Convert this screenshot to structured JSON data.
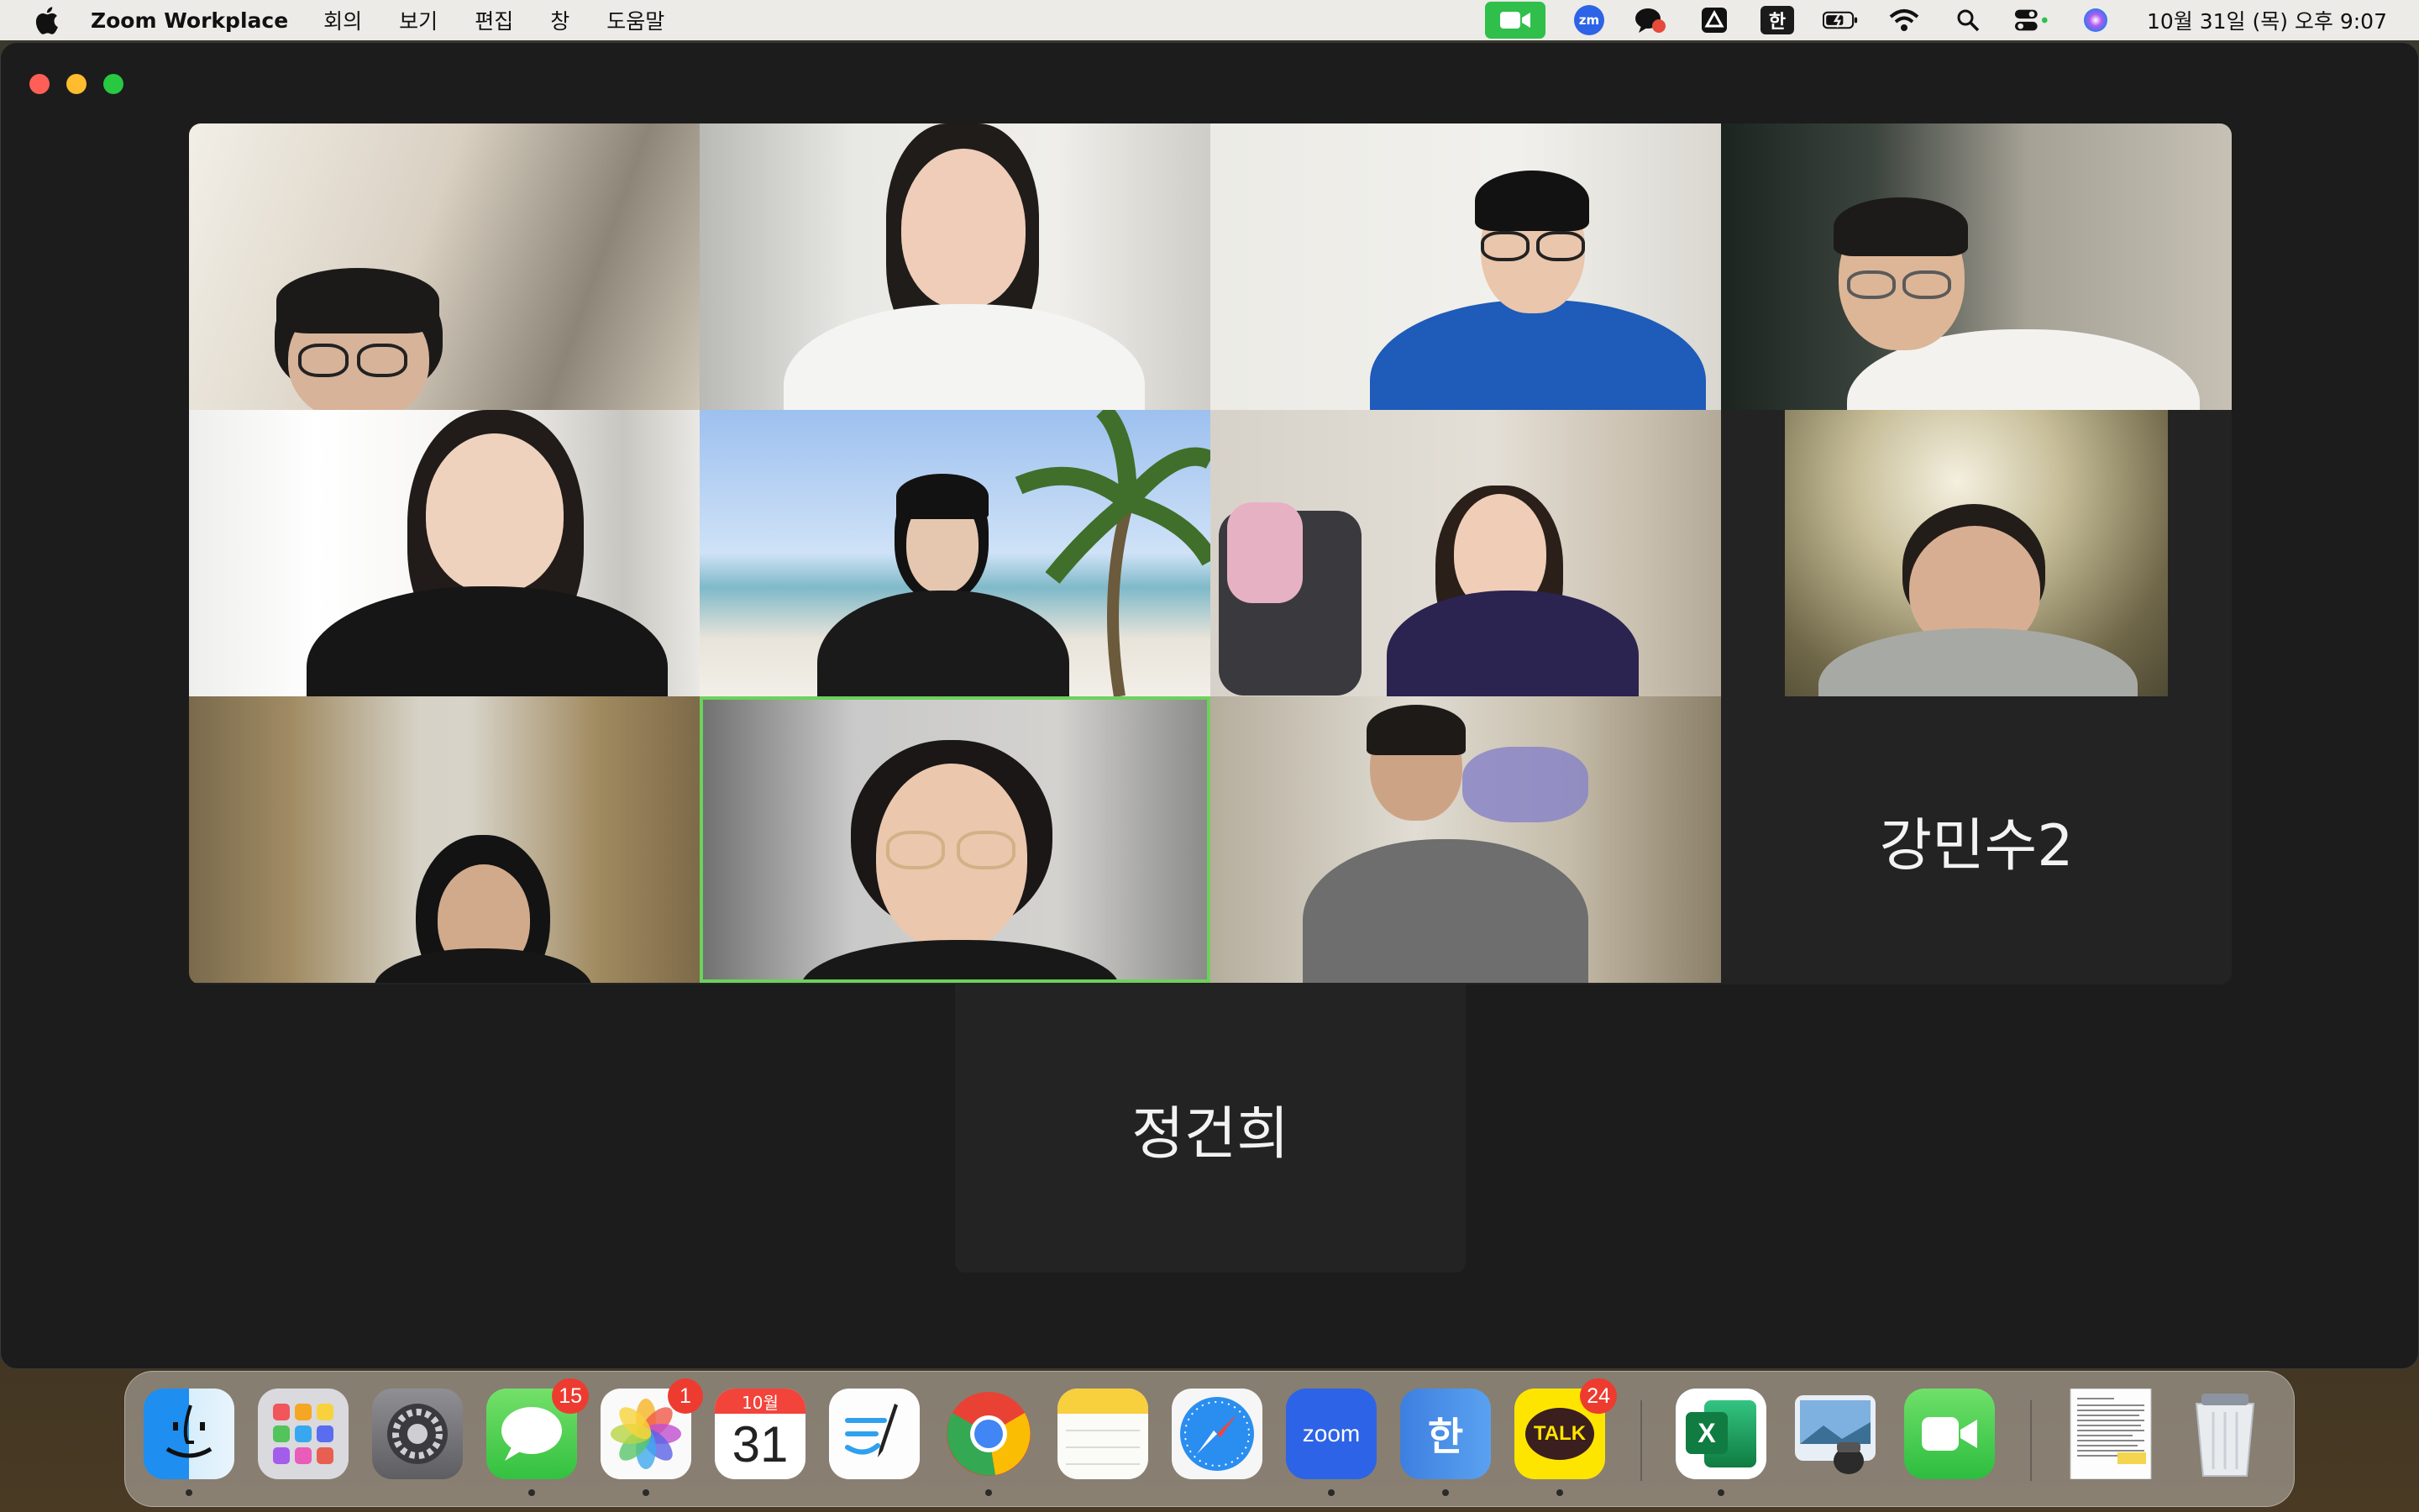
{
  "menubar": {
    "app_name": "Zoom Workplace",
    "items": [
      "회의",
      "보기",
      "편집",
      "창",
      "도움말"
    ],
    "status": {
      "zoom_icon": "zm",
      "input_source": "한",
      "datetime": "10월 31일 (목) 오후 9:07"
    }
  },
  "meeting": {
    "tiles_named": {
      "gangminsu2": "강민수2",
      "jeonggeonhui": "정건희"
    }
  },
  "dock": {
    "apps": [
      {
        "name": "Finder",
        "icon": "finder-icon"
      },
      {
        "name": "Launchpad",
        "icon": "launchpad-icon"
      },
      {
        "name": "System Settings",
        "icon": "settings-icon"
      },
      {
        "name": "Messages",
        "icon": "messages-icon",
        "badge": "15"
      },
      {
        "name": "Photos",
        "icon": "photos-icon",
        "badge": "1"
      },
      {
        "name": "Calendar",
        "icon": "calendar-icon",
        "month": "10월",
        "day": "31"
      },
      {
        "name": "Freeform",
        "icon": "freeform-icon"
      },
      {
        "name": "Chrome",
        "icon": "chrome-icon"
      },
      {
        "name": "Notes",
        "icon": "notes-icon"
      },
      {
        "name": "Safari",
        "icon": "safari-icon"
      },
      {
        "name": "Zoom",
        "icon": "zoom-icon",
        "label": "zoom"
      },
      {
        "name": "Dictionary",
        "icon": "hangul-dictionary-icon",
        "label": "한"
      },
      {
        "name": "KakaoTalk",
        "icon": "kakaotalk-icon",
        "label": "TALK",
        "badge": "24"
      },
      {
        "name": "Excel",
        "icon": "excel-icon",
        "label": "X"
      },
      {
        "name": "Preview",
        "icon": "preview-icon"
      },
      {
        "name": "FaceTime",
        "icon": "facetime-icon"
      },
      {
        "name": "Document",
        "icon": "document-thumbnail-icon"
      },
      {
        "name": "Trash",
        "icon": "trash-icon"
      }
    ]
  },
  "colors": {
    "active_speaker": "#6cd25c",
    "zoom_blue": "#2d63e6",
    "badge_red": "#ee3b30"
  }
}
